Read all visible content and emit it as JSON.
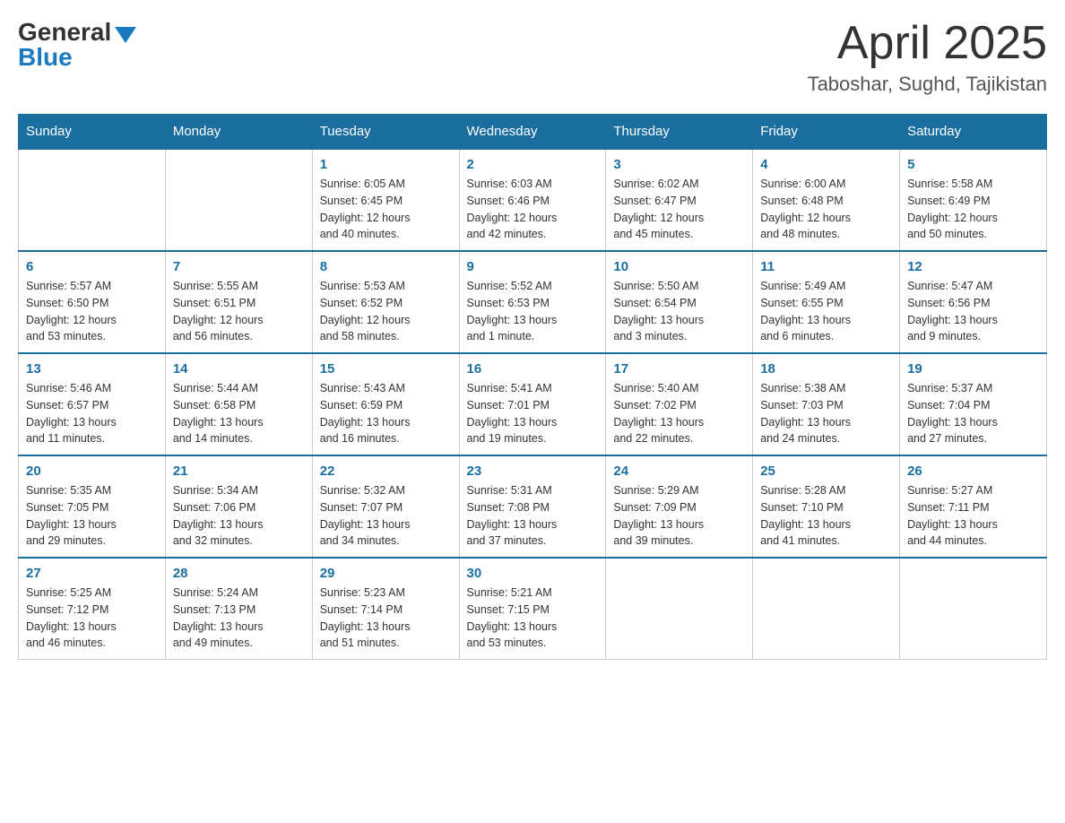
{
  "header": {
    "logo_general": "General",
    "logo_blue": "Blue",
    "month_year": "April 2025",
    "location": "Taboshar, Sughd, Tajikistan"
  },
  "days_of_week": [
    "Sunday",
    "Monday",
    "Tuesday",
    "Wednesday",
    "Thursday",
    "Friday",
    "Saturday"
  ],
  "weeks": [
    [
      {
        "day": "",
        "info": ""
      },
      {
        "day": "",
        "info": ""
      },
      {
        "day": "1",
        "info": "Sunrise: 6:05 AM\nSunset: 6:45 PM\nDaylight: 12 hours\nand 40 minutes."
      },
      {
        "day": "2",
        "info": "Sunrise: 6:03 AM\nSunset: 6:46 PM\nDaylight: 12 hours\nand 42 minutes."
      },
      {
        "day": "3",
        "info": "Sunrise: 6:02 AM\nSunset: 6:47 PM\nDaylight: 12 hours\nand 45 minutes."
      },
      {
        "day": "4",
        "info": "Sunrise: 6:00 AM\nSunset: 6:48 PM\nDaylight: 12 hours\nand 48 minutes."
      },
      {
        "day": "5",
        "info": "Sunrise: 5:58 AM\nSunset: 6:49 PM\nDaylight: 12 hours\nand 50 minutes."
      }
    ],
    [
      {
        "day": "6",
        "info": "Sunrise: 5:57 AM\nSunset: 6:50 PM\nDaylight: 12 hours\nand 53 minutes."
      },
      {
        "day": "7",
        "info": "Sunrise: 5:55 AM\nSunset: 6:51 PM\nDaylight: 12 hours\nand 56 minutes."
      },
      {
        "day": "8",
        "info": "Sunrise: 5:53 AM\nSunset: 6:52 PM\nDaylight: 12 hours\nand 58 minutes."
      },
      {
        "day": "9",
        "info": "Sunrise: 5:52 AM\nSunset: 6:53 PM\nDaylight: 13 hours\nand 1 minute."
      },
      {
        "day": "10",
        "info": "Sunrise: 5:50 AM\nSunset: 6:54 PM\nDaylight: 13 hours\nand 3 minutes."
      },
      {
        "day": "11",
        "info": "Sunrise: 5:49 AM\nSunset: 6:55 PM\nDaylight: 13 hours\nand 6 minutes."
      },
      {
        "day": "12",
        "info": "Sunrise: 5:47 AM\nSunset: 6:56 PM\nDaylight: 13 hours\nand 9 minutes."
      }
    ],
    [
      {
        "day": "13",
        "info": "Sunrise: 5:46 AM\nSunset: 6:57 PM\nDaylight: 13 hours\nand 11 minutes."
      },
      {
        "day": "14",
        "info": "Sunrise: 5:44 AM\nSunset: 6:58 PM\nDaylight: 13 hours\nand 14 minutes."
      },
      {
        "day": "15",
        "info": "Sunrise: 5:43 AM\nSunset: 6:59 PM\nDaylight: 13 hours\nand 16 minutes."
      },
      {
        "day": "16",
        "info": "Sunrise: 5:41 AM\nSunset: 7:01 PM\nDaylight: 13 hours\nand 19 minutes."
      },
      {
        "day": "17",
        "info": "Sunrise: 5:40 AM\nSunset: 7:02 PM\nDaylight: 13 hours\nand 22 minutes."
      },
      {
        "day": "18",
        "info": "Sunrise: 5:38 AM\nSunset: 7:03 PM\nDaylight: 13 hours\nand 24 minutes."
      },
      {
        "day": "19",
        "info": "Sunrise: 5:37 AM\nSunset: 7:04 PM\nDaylight: 13 hours\nand 27 minutes."
      }
    ],
    [
      {
        "day": "20",
        "info": "Sunrise: 5:35 AM\nSunset: 7:05 PM\nDaylight: 13 hours\nand 29 minutes."
      },
      {
        "day": "21",
        "info": "Sunrise: 5:34 AM\nSunset: 7:06 PM\nDaylight: 13 hours\nand 32 minutes."
      },
      {
        "day": "22",
        "info": "Sunrise: 5:32 AM\nSunset: 7:07 PM\nDaylight: 13 hours\nand 34 minutes."
      },
      {
        "day": "23",
        "info": "Sunrise: 5:31 AM\nSunset: 7:08 PM\nDaylight: 13 hours\nand 37 minutes."
      },
      {
        "day": "24",
        "info": "Sunrise: 5:29 AM\nSunset: 7:09 PM\nDaylight: 13 hours\nand 39 minutes."
      },
      {
        "day": "25",
        "info": "Sunrise: 5:28 AM\nSunset: 7:10 PM\nDaylight: 13 hours\nand 41 minutes."
      },
      {
        "day": "26",
        "info": "Sunrise: 5:27 AM\nSunset: 7:11 PM\nDaylight: 13 hours\nand 44 minutes."
      }
    ],
    [
      {
        "day": "27",
        "info": "Sunrise: 5:25 AM\nSunset: 7:12 PM\nDaylight: 13 hours\nand 46 minutes."
      },
      {
        "day": "28",
        "info": "Sunrise: 5:24 AM\nSunset: 7:13 PM\nDaylight: 13 hours\nand 49 minutes."
      },
      {
        "day": "29",
        "info": "Sunrise: 5:23 AM\nSunset: 7:14 PM\nDaylight: 13 hours\nand 51 minutes."
      },
      {
        "day": "30",
        "info": "Sunrise: 5:21 AM\nSunset: 7:15 PM\nDaylight: 13 hours\nand 53 minutes."
      },
      {
        "day": "",
        "info": ""
      },
      {
        "day": "",
        "info": ""
      },
      {
        "day": "",
        "info": ""
      }
    ]
  ]
}
